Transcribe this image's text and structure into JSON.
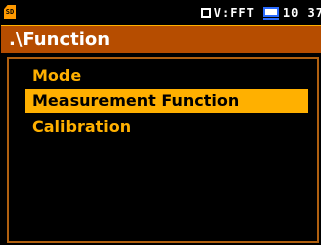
{
  "status_bar": {
    "storage_icon_label": "SD",
    "mode_text": "V:FFT",
    "time_text": "10 37"
  },
  "path": {
    "title": ".\\Function"
  },
  "menu": {
    "items": [
      {
        "label": "Mode",
        "selected": false
      },
      {
        "label": "Measurement Function",
        "selected": true
      },
      {
        "label": "Calibration",
        "selected": false
      }
    ]
  },
  "colors": {
    "background": "#000000",
    "accent": "#ffb000",
    "path_bar": "#b64d00",
    "selected_text": "#000000",
    "monitor_icon": "#2a6bff"
  }
}
